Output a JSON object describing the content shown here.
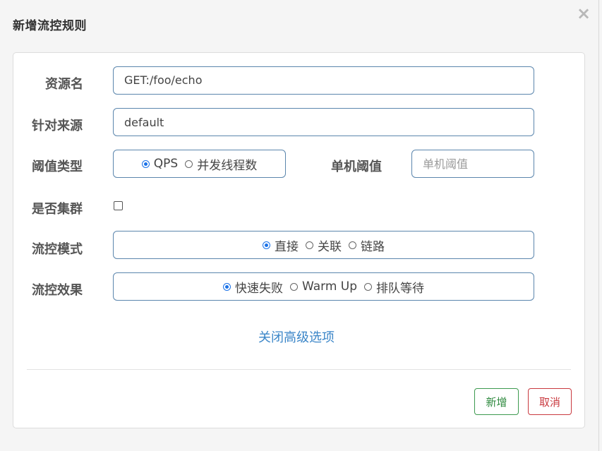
{
  "dialog": {
    "title": "新增流控规则",
    "close_label": "×"
  },
  "form": {
    "resource": {
      "label": "资源名",
      "value": "GET:/foo/echo"
    },
    "source": {
      "label": "针对来源",
      "value": "default"
    },
    "threshold_type": {
      "label": "阈值类型",
      "options": [
        "QPS",
        "并发线程数"
      ],
      "selected": "QPS"
    },
    "single_threshold": {
      "label": "单机阈值",
      "placeholder": "单机阈值",
      "value": ""
    },
    "cluster": {
      "label": "是否集群",
      "checked": false
    },
    "flow_mode": {
      "label": "流控模式",
      "options": [
        "直接",
        "关联",
        "链路"
      ],
      "selected": "直接"
    },
    "flow_effect": {
      "label": "流控效果",
      "options": [
        "快速失败",
        "Warm Up",
        "排队等待"
      ],
      "selected": "快速失败"
    },
    "advanced_link": "关闭高级选项"
  },
  "footer": {
    "add_label": "新增",
    "cancel_label": "取消"
  }
}
